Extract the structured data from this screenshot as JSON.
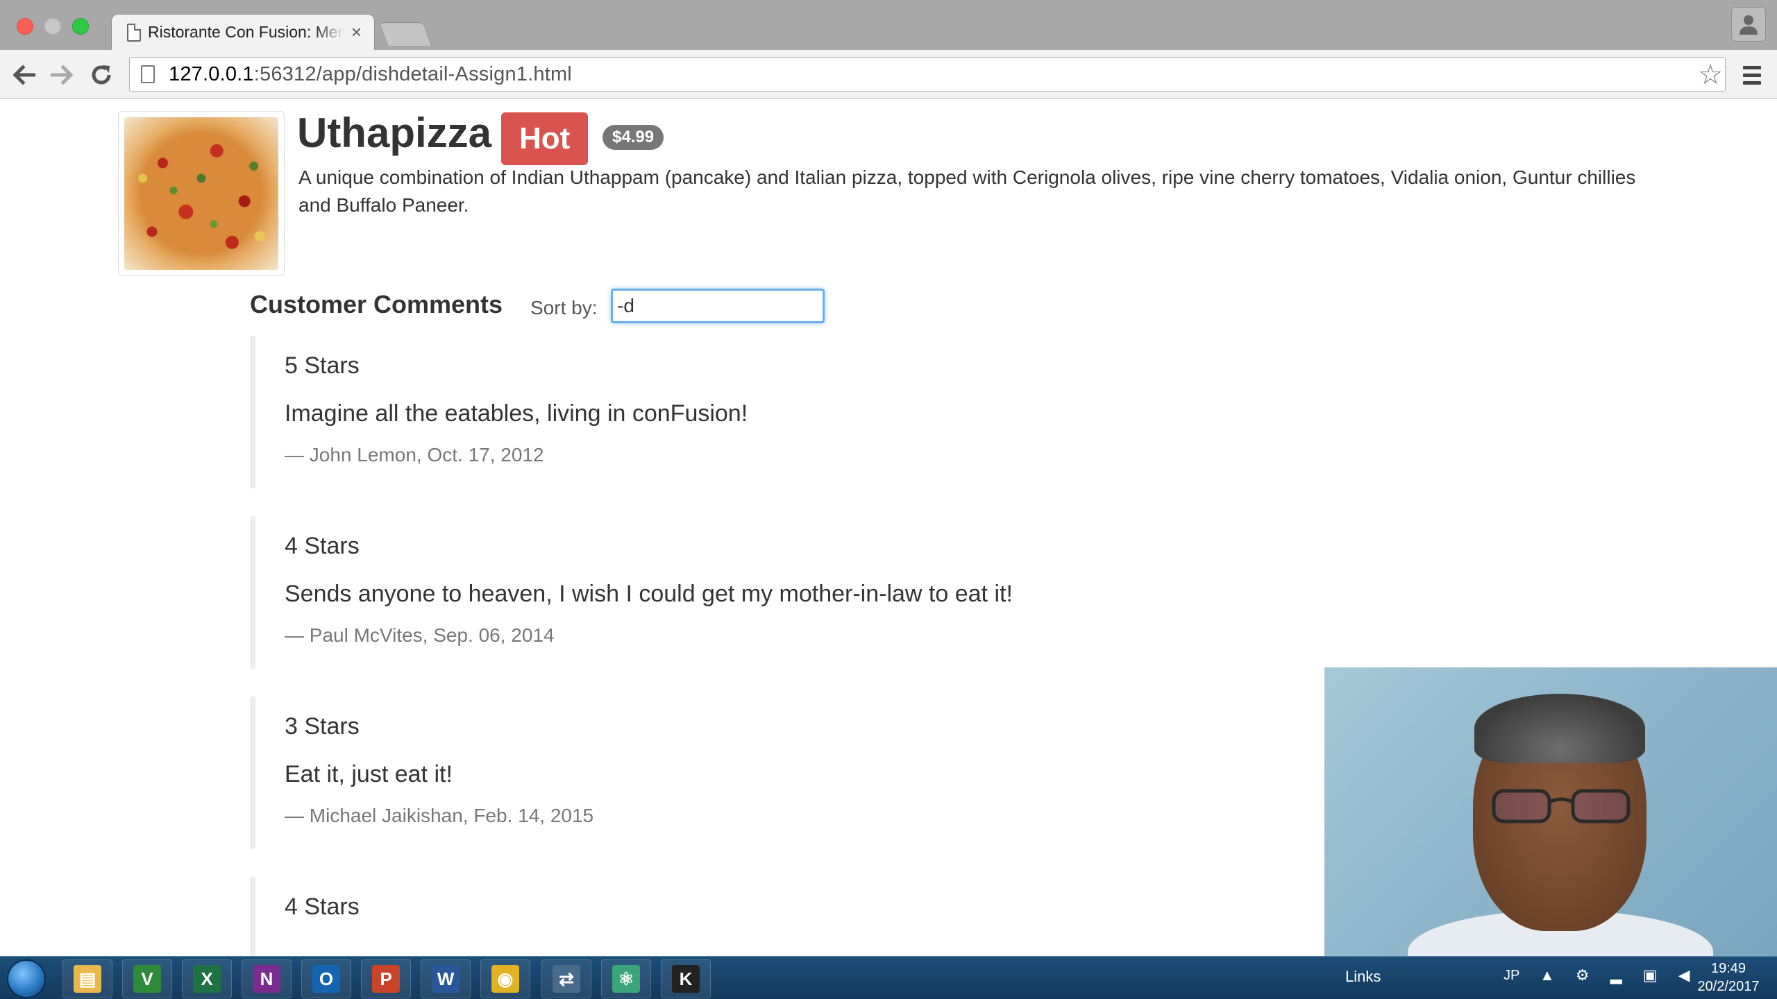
{
  "browser": {
    "tab_title": "Ristorante Con Fusion: Menu",
    "tab_close": "×",
    "url_host": "127.0.0.1",
    "url_path": ":56312/app/dishdetail-Assign1.html"
  },
  "dish": {
    "name": "Uthapizza",
    "label": "Hot",
    "price": "$4.99",
    "description": "A unique combination of Indian Uthappam (pancake) and Italian pizza, topped with Cerignola olives, ripe vine cherry tomatoes, Vidalia onion, Guntur chillies and Buffalo Paneer."
  },
  "comments_section": {
    "heading": "Customer Comments",
    "sort_label": "Sort by:",
    "sort_value": "-d"
  },
  "comments": [
    {
      "stars": "5 Stars",
      "text": "Imagine all the eatables, living in conFusion!",
      "author": "— John Lemon, Oct. 17, 2012"
    },
    {
      "stars": "4 Stars",
      "text": "Sends anyone to heaven, I wish I could get my mother-in-law to eat it!",
      "author": "— Paul McVites, Sep. 06, 2014"
    },
    {
      "stars": "3 Stars",
      "text": "Eat it, just eat it!",
      "author": "— Michael Jaikishan, Feb. 14, 2015"
    },
    {
      "stars": "4 Stars",
      "text": "",
      "author": ""
    }
  ],
  "taskbar": {
    "apps": [
      {
        "name": "explorer",
        "glyph": "▤",
        "color": "#e8b84a"
      },
      {
        "name": "vim",
        "glyph": "V",
        "color": "#2f8a3a"
      },
      {
        "name": "excel",
        "glyph": "X",
        "color": "#1f7244"
      },
      {
        "name": "onenote",
        "glyph": "N",
        "color": "#7b2c8f"
      },
      {
        "name": "outlook",
        "glyph": "O",
        "color": "#1464b4"
      },
      {
        "name": "powerpoint",
        "glyph": "P",
        "color": "#c9442a"
      },
      {
        "name": "word",
        "glyph": "W",
        "color": "#2b579a"
      },
      {
        "name": "chrome",
        "glyph": "◉",
        "color": "#e0b224"
      },
      {
        "name": "network",
        "glyph": "⇄",
        "color": "#4a6a8a"
      },
      {
        "name": "atom",
        "glyph": "⚛",
        "color": "#3aa57a"
      },
      {
        "name": "kindle",
        "glyph": "K",
        "color": "#222222"
      }
    ],
    "links_label": "Links",
    "lang": "JP",
    "tray_icons": "▲ ⚙ ▂ ▣ ◀",
    "time": "19:49",
    "date": "20/2/2017"
  },
  "colors": {
    "hot_badge": "#d9534f",
    "price_badge": "#777777",
    "focus_ring": "#66afe9"
  }
}
